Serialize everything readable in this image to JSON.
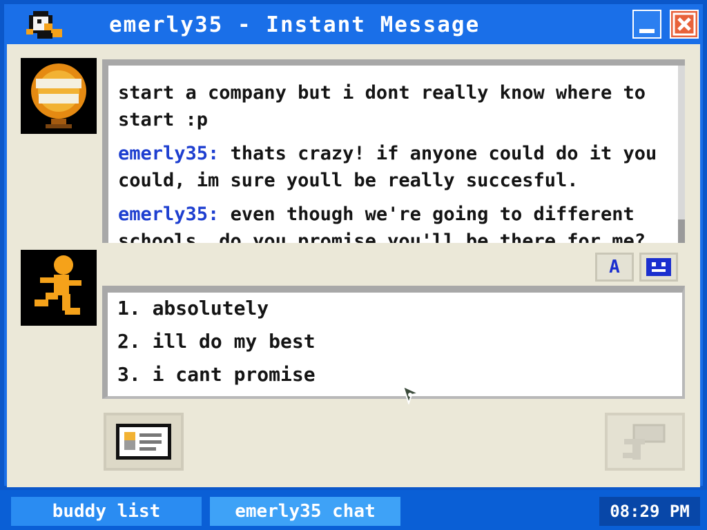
{
  "window": {
    "title": "emerly35 - Instant Message",
    "minimize_icon": "minimize-icon",
    "close_icon": "close-icon"
  },
  "buddy": {
    "avatar_icon": "cold-play-globe-avatar-icon"
  },
  "me": {
    "avatar_icon": "running-man-avatar-icon"
  },
  "history": {
    "partial_line": "start a company but i dont really know where to start :p",
    "messages": [
      {
        "sender": "emerly35:",
        "text": " thats crazy! if anyone could do it you could, im sure youll be really succesful."
      },
      {
        "sender": "emerly35:",
        "text": " even though we're going to different schools, do you promise you'll be there for me?"
      }
    ]
  },
  "format_buttons": {
    "font_label": "A",
    "face_icon": "smiley-face-icon"
  },
  "reply_options": [
    "1. absolutely",
    "2. ill do my best",
    "3. i cant promise"
  ],
  "buttons": {
    "profile_icon": "profile-card-icon",
    "send_icon": "send-message-icon"
  },
  "taskbar": {
    "buddy_list_label": "buddy list",
    "chat_label": "emerly35 chat",
    "clock": "08:29 PM"
  },
  "colors": {
    "titlebar": "#1a6fe8",
    "client": "#ebe8d8",
    "sender": "#1e3fd0"
  }
}
